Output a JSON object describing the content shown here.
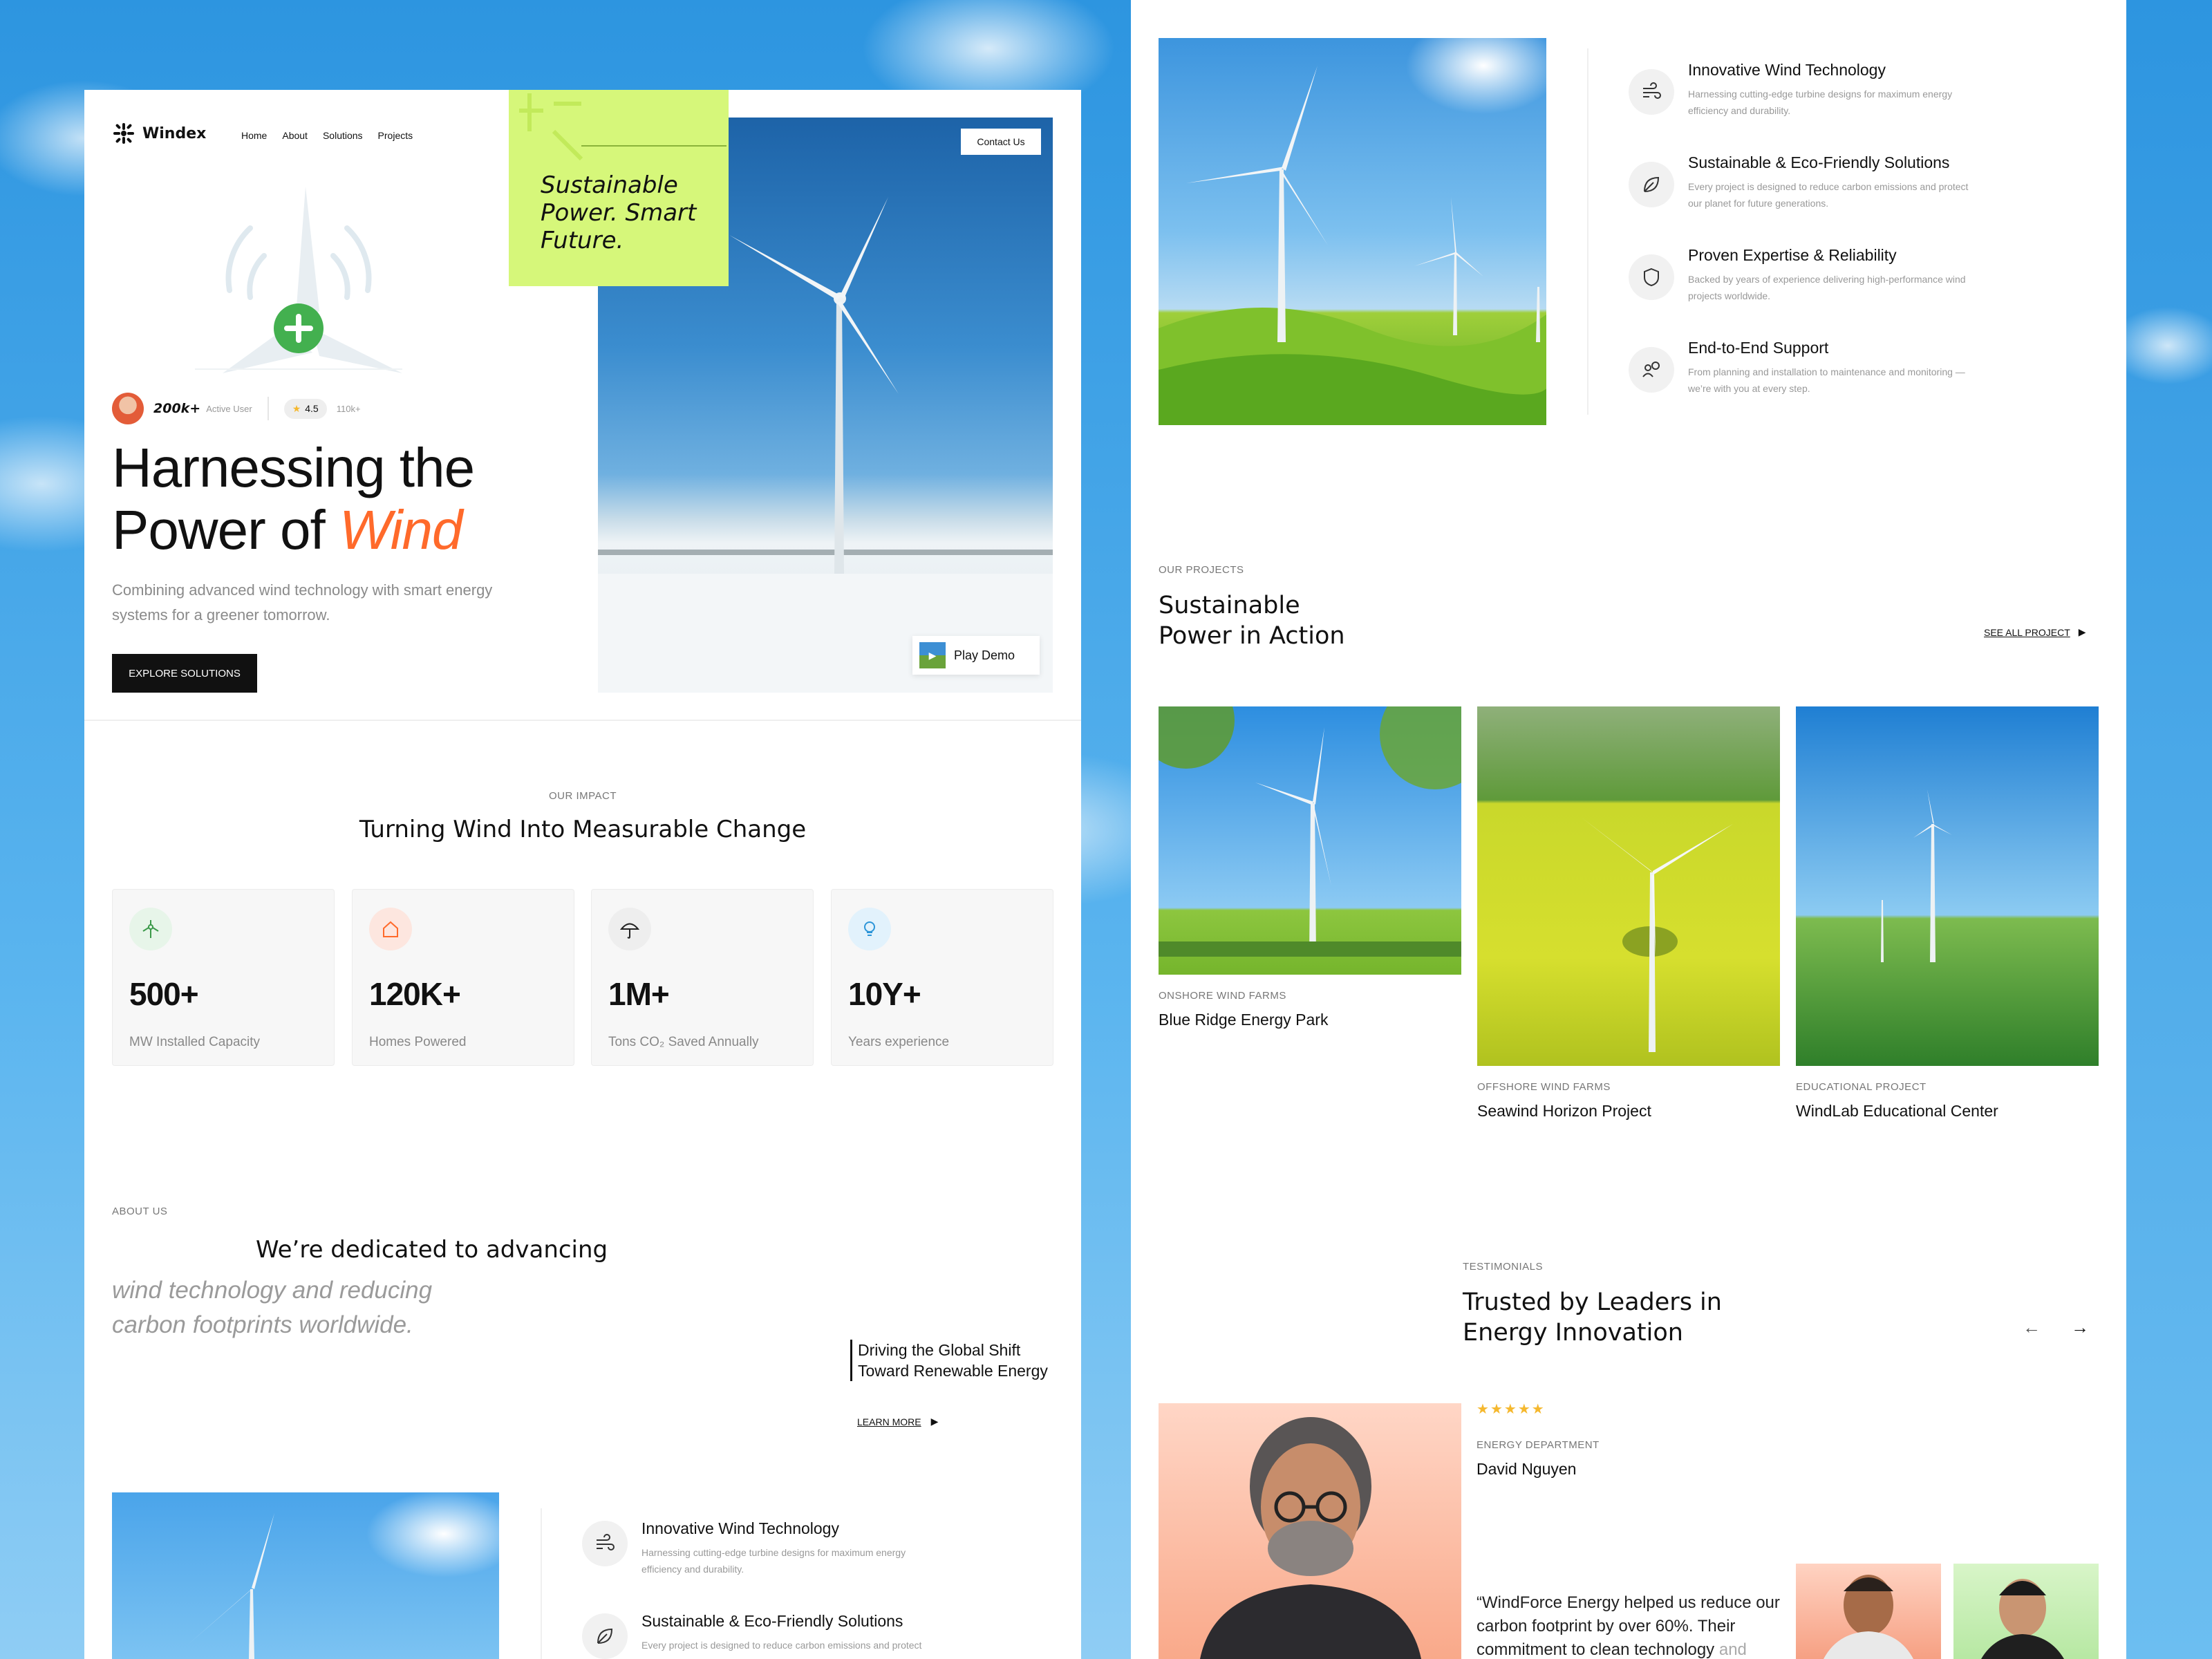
{
  "brand": {
    "name": "Windex"
  },
  "nav": {
    "items": [
      "Home",
      "About",
      "Solutions",
      "Projects"
    ],
    "contact": "Contact Us"
  },
  "hero": {
    "tagline": "Sustainable Power. Smart Future.",
    "active_count": "200k+",
    "active_label": "Active User",
    "rating": "4.5",
    "reviews": "110k+",
    "title_line1": "Harnessing the",
    "title_line2": "Power of ",
    "title_accent": "Wind",
    "subtitle": "Combining advanced wind technology with smart energy systems for a greener tomorrow.",
    "cta": "EXPLORE SOLUTIONS",
    "play": "Play Demo"
  },
  "impact": {
    "label": "OUR IMPACT",
    "title": "Turning Wind Into Measurable Change",
    "stats": [
      {
        "value": "500+",
        "label": "MW Installed Capacity",
        "icon": "wind-turbine-icon",
        "color": "#e7f5e9"
      },
      {
        "value": "120K+",
        "label": "Homes Powered",
        "icon": "home-icon",
        "color": "#fde6df"
      },
      {
        "value": "1M+",
        "label": "Tons CO₂ Saved Annually",
        "icon": "umbrella-icon",
        "color": "#eeeeee"
      },
      {
        "value": "10Y+",
        "label": "Years experience",
        "icon": "lightbulb-icon",
        "color": "#e2f2fc"
      }
    ]
  },
  "about": {
    "label": "ABOUT US",
    "line1": "We’re dedicated to advancing",
    "line2": "wind technology and reducing",
    "line3": "carbon footprints worldwide.",
    "aside_1": "Driving the Global Shift",
    "aside_2": "Toward Renewable Energy",
    "link": "LEARN MORE"
  },
  "features": [
    {
      "title": "Innovative Wind Technology",
      "desc_1": "Harnessing cutting-edge turbine designs for maximum energy",
      "desc_2": "efficiency and durability.",
      "icon": "wind-icon"
    },
    {
      "title": "Sustainable & Eco-Friendly Solutions",
      "desc_1": "Every project is designed to reduce carbon emissions and protect",
      "desc_2": "our planet for future generations.",
      "icon": "leaf-icon"
    },
    {
      "title": "Proven Expertise & Reliability",
      "desc_1": "Backed by years of experience delivering high-performance wind",
      "desc_2": "projects worldwide.",
      "icon": "shield-icon"
    },
    {
      "title": "End-to-End Support",
      "desc_1": "From planning and installation to maintenance and monitoring —",
      "desc_2": "we’re with you at every step.",
      "icon": "support-icon"
    }
  ],
  "projects": {
    "label": "OUR PROJECTS",
    "title_1": "Sustainable",
    "title_2": "Power in Action",
    "see_all": "SEE ALL PROJECT",
    "items": [
      {
        "category": "ONSHORE WIND FARMS",
        "name": "Blue Ridge Energy Park"
      },
      {
        "category": "OFFSHORE WIND FARMS",
        "name": "Seawind Horizon Project"
      },
      {
        "category": "EDUCATIONAL PROJECT",
        "name": "WindLab Educational Center"
      }
    ]
  },
  "testimonials": {
    "label": "TESTIMONIALS",
    "title_1": "Trusted by Leaders in",
    "title_2": "Energy Innovation",
    "stars": 5,
    "department": "ENERGY DEPARTMENT",
    "name": "David Nguyen",
    "quote_1": "“WindForce Energy helped us reduce our",
    "quote_2": "carbon footprint by over 60%. Their",
    "quote_3": "commitment to clean technology",
    "quote_3_faded": "and"
  },
  "colors": {
    "accent": "#ff6a2b",
    "lime": "#d6f77a",
    "dark": "#111111",
    "star": "#f5b82e"
  }
}
